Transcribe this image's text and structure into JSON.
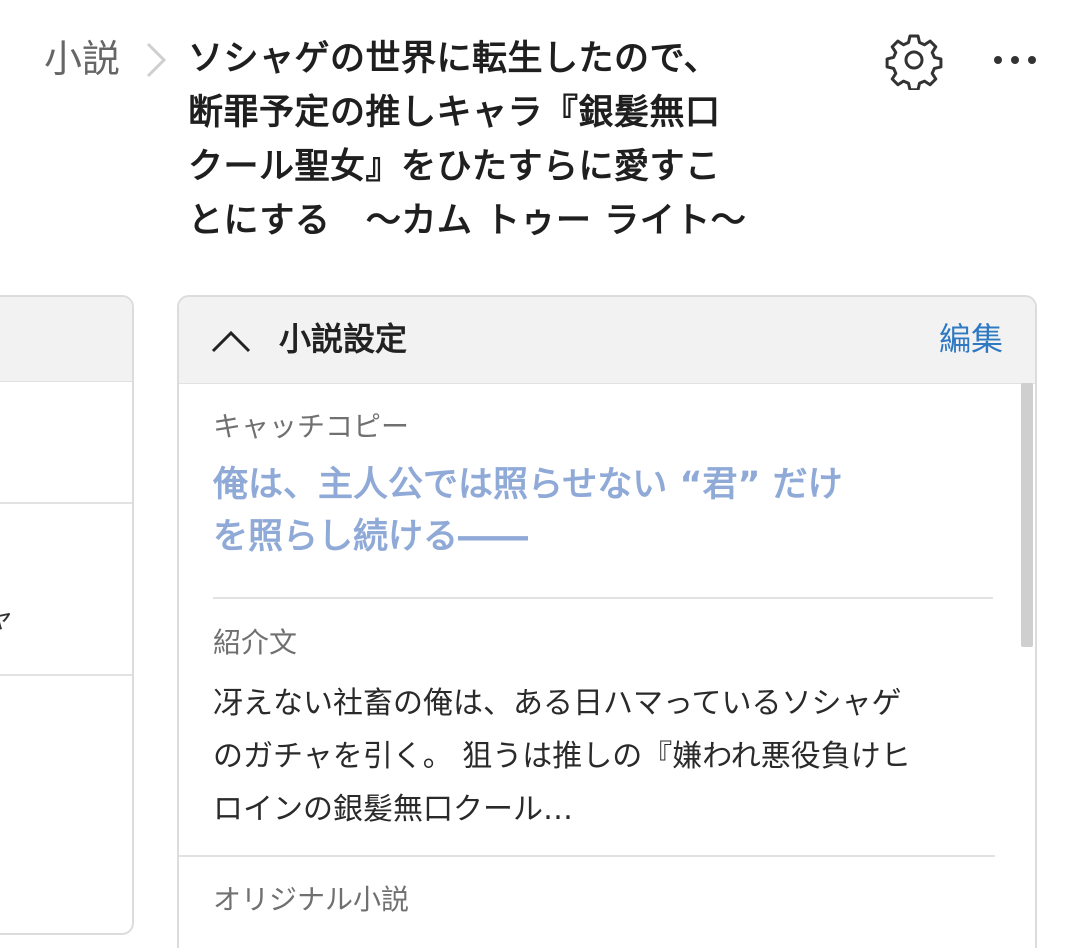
{
  "header": {
    "breadcrumb_parent": "小説",
    "title": "ソシャゲの世界に転生したので、\n断罪予定の推しキャラ『銀髪無口\nクール聖女』をひたすらに愛すこ\nとにする　〜カム トゥー ライト〜",
    "icons": [
      "chevron-right-icon",
      "gear-icon",
      "more-icon"
    ]
  },
  "left_panel": {
    "partial_glyph": "ャ"
  },
  "settings": {
    "title": "小説設定",
    "edit_label": "編集",
    "catch_copy_label": "キャッチコピー",
    "catch_copy": "俺は、主人公では照らせない “君” だけ\nを照らし続ける――",
    "intro_label": "紹介文",
    "intro_text": "冴えない社畜の俺は、ある日ハマっているソシャゲ\nのガチャを引く。 狙うは推しの『嫌われ悪役負けヒ\nロインの銀髪無口クール…",
    "original_label": "オリジナル小説"
  },
  "colors": {
    "accent": "#2f79c2",
    "catch_copy": "#90aad8",
    "header_bg": "#f2f2f2",
    "border": "#dcdcdc"
  }
}
